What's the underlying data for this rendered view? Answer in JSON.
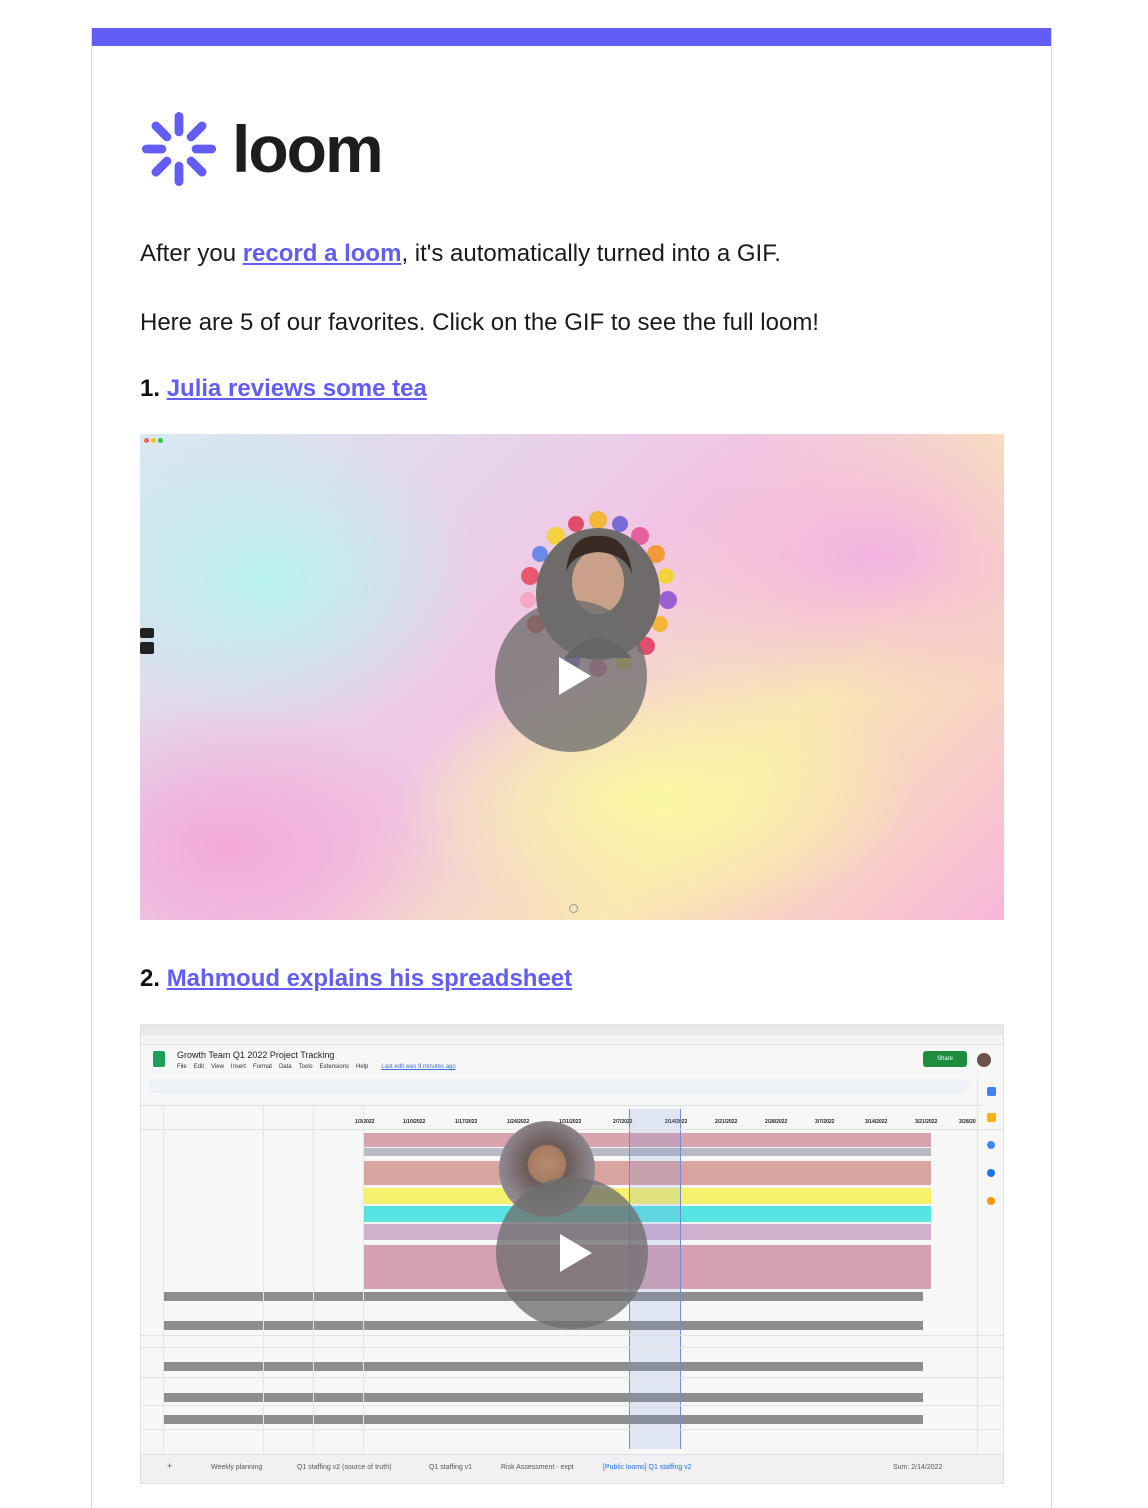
{
  "brand": {
    "name": "loom",
    "color": "#625df5",
    "logo_icon": "loom-starburst-icon"
  },
  "intro": {
    "before_link": "After you ",
    "link_text": "record a loom",
    "after_link": ", it's automatically turned into a GIF."
  },
  "subtitle": "Here are 5 of our favorites. Click on the GIF to see the full loom!",
  "items": [
    {
      "number": "1.",
      "title": "Julia reviews some tea",
      "media_icon": "play-icon"
    },
    {
      "number": "2.",
      "title": "Mahmoud explains his spreadsheet",
      "media_icon": "play-icon"
    }
  ],
  "spreadsheet": {
    "doc_title": "Growth Team Q1 2022 Project Tracking",
    "menu": [
      "File",
      "Edit",
      "View",
      "Insert",
      "Format",
      "Data",
      "Tools",
      "Extensions",
      "Help"
    ],
    "last_edit": "Last edit was 9 minutes ago",
    "share_label": "Share",
    "dates": [
      "1/3/2022",
      "1/10/2022",
      "1/17/2022",
      "1/24/2022",
      "1/31/2022",
      "2/7/2022",
      "2/14/2022",
      "2/21/2022",
      "2/28/2022",
      "3/7/2022",
      "3/14/2022",
      "3/21/2022",
      "3/28/20"
    ],
    "tabs": [
      "Weekly planning",
      "Q1 staffing v2 (source of truth)",
      "Q1 staffing v1",
      "Risk Assessment - expt",
      "[Public looms] Q1 staffing v2"
    ],
    "sum_label": "Sum: 2/14/2022"
  }
}
